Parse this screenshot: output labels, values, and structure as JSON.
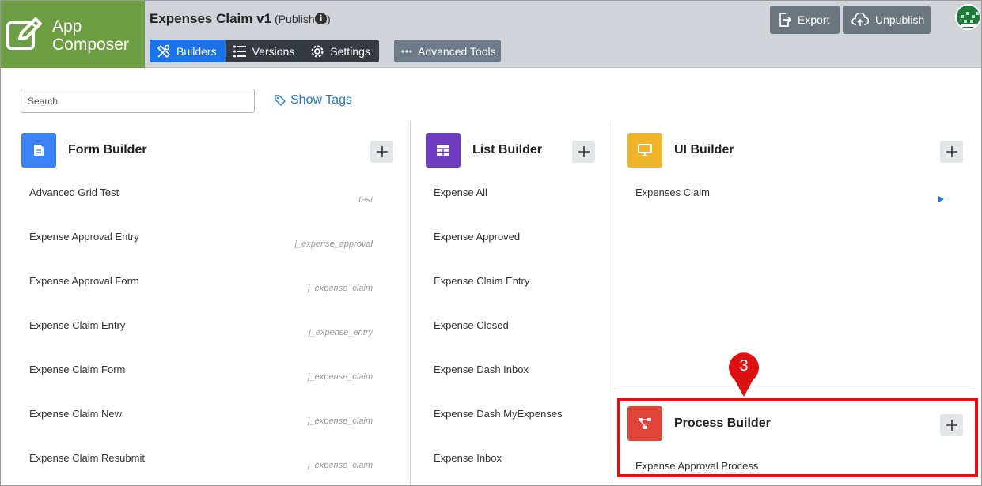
{
  "brand": {
    "line1": "App",
    "line2": "Composer",
    "icon": "edit-square-icon"
  },
  "app": {
    "title": "Expenses Claim v1",
    "status": "(Published)",
    "info_icon": "info-icon"
  },
  "tabs": [
    {
      "label": "Builders",
      "icon": "tools-icon",
      "active": true
    },
    {
      "label": "Versions",
      "icon": "list-icon",
      "active": false
    },
    {
      "label": "Settings",
      "icon": "gear-icon",
      "active": false
    }
  ],
  "advanced_tools": {
    "label": "Advanced Tools",
    "icon": "dots-icon"
  },
  "header_actions": {
    "export_label": "Export",
    "unpublish_label": "Unpublish"
  },
  "search": {
    "placeholder": "Search",
    "value": ""
  },
  "show_tags": {
    "label": "Show Tags",
    "icon": "tag-icon"
  },
  "form_builder": {
    "title": "Form Builder",
    "icon_color": "#3b82f6",
    "items": [
      {
        "label": "Advanced Grid Test",
        "tag": "test"
      },
      {
        "label": "Expense Approval Entry",
        "tag": "j_expense_approval"
      },
      {
        "label": "Expense Approval Form",
        "tag": "j_expense_claim"
      },
      {
        "label": "Expense Claim Entry",
        "tag": "j_expense_entry"
      },
      {
        "label": "Expense Claim Form",
        "tag": "j_expense_claim"
      },
      {
        "label": "Expense Claim New",
        "tag": "j_expense_claim"
      },
      {
        "label": "Expense Claim Resubmit",
        "tag": "j_expense_claim"
      }
    ]
  },
  "list_builder": {
    "title": "List Builder",
    "icon_color": "#6f3cc0",
    "items": [
      {
        "label": "Expense All"
      },
      {
        "label": "Expense Approved"
      },
      {
        "label": "Expense Claim Entry"
      },
      {
        "label": "Expense Closed"
      },
      {
        "label": "Expense Dash Inbox"
      },
      {
        "label": "Expense Dash MyExpenses"
      },
      {
        "label": "Expense Inbox"
      }
    ]
  },
  "ui_builder": {
    "title": "UI Builder",
    "icon_color": "#f0b429",
    "items": [
      {
        "label": "Expenses Claim"
      }
    ]
  },
  "process_builder": {
    "title": "Process Builder",
    "icon_color": "#e0443a",
    "items": [
      {
        "label": "Expense Approval Process"
      }
    ]
  },
  "annotation": {
    "number": "3",
    "color": "#dd1111"
  }
}
